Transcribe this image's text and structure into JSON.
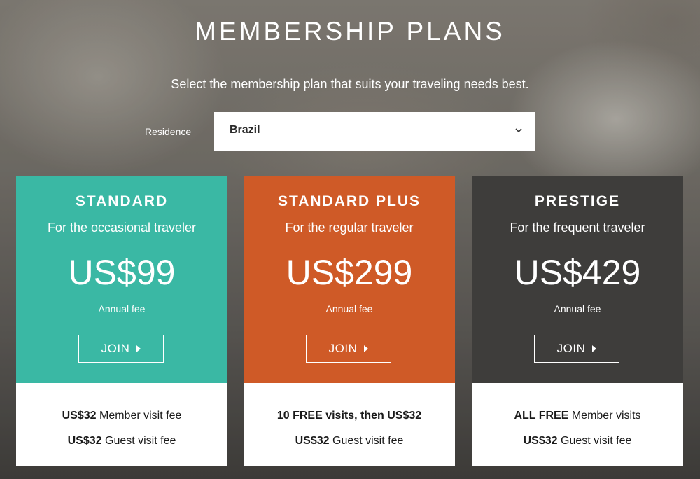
{
  "page": {
    "title": "MEMBERSHIP PLANS",
    "subtitle": "Select the membership plan that suits your traveling needs best."
  },
  "residence": {
    "label": "Residence",
    "selected": "Brazil",
    "icon": "chevron-down-icon"
  },
  "plans": [
    {
      "name": "STANDARD",
      "tagline": "For the occasional traveler",
      "price": "US$99",
      "fee_label": "Annual fee",
      "join_label": "JOIN",
      "color": "#3ab8a4",
      "line1_bold": "US$32",
      "line1_rest": " Member visit fee",
      "line2_bold": "US$32",
      "line2_rest": " Guest visit fee"
    },
    {
      "name": "STANDARD PLUS",
      "tagline": "For the regular traveler",
      "price": "US$299",
      "fee_label": "Annual fee",
      "join_label": "JOIN",
      "color": "#cf5a27",
      "line1_bold": "10 FREE visits, then US$32",
      "line1_rest": "",
      "line2_bold": "US$32",
      "line2_rest": " Guest visit fee"
    },
    {
      "name": "PRESTIGE",
      "tagline": "For the frequent traveler",
      "price": "US$429",
      "fee_label": "Annual fee",
      "join_label": "JOIN",
      "color": "#3e3d3b",
      "line1_bold": "ALL FREE",
      "line1_rest": " Member visits",
      "line2_bold": "US$32",
      "line2_rest": " Guest visit fee"
    }
  ]
}
